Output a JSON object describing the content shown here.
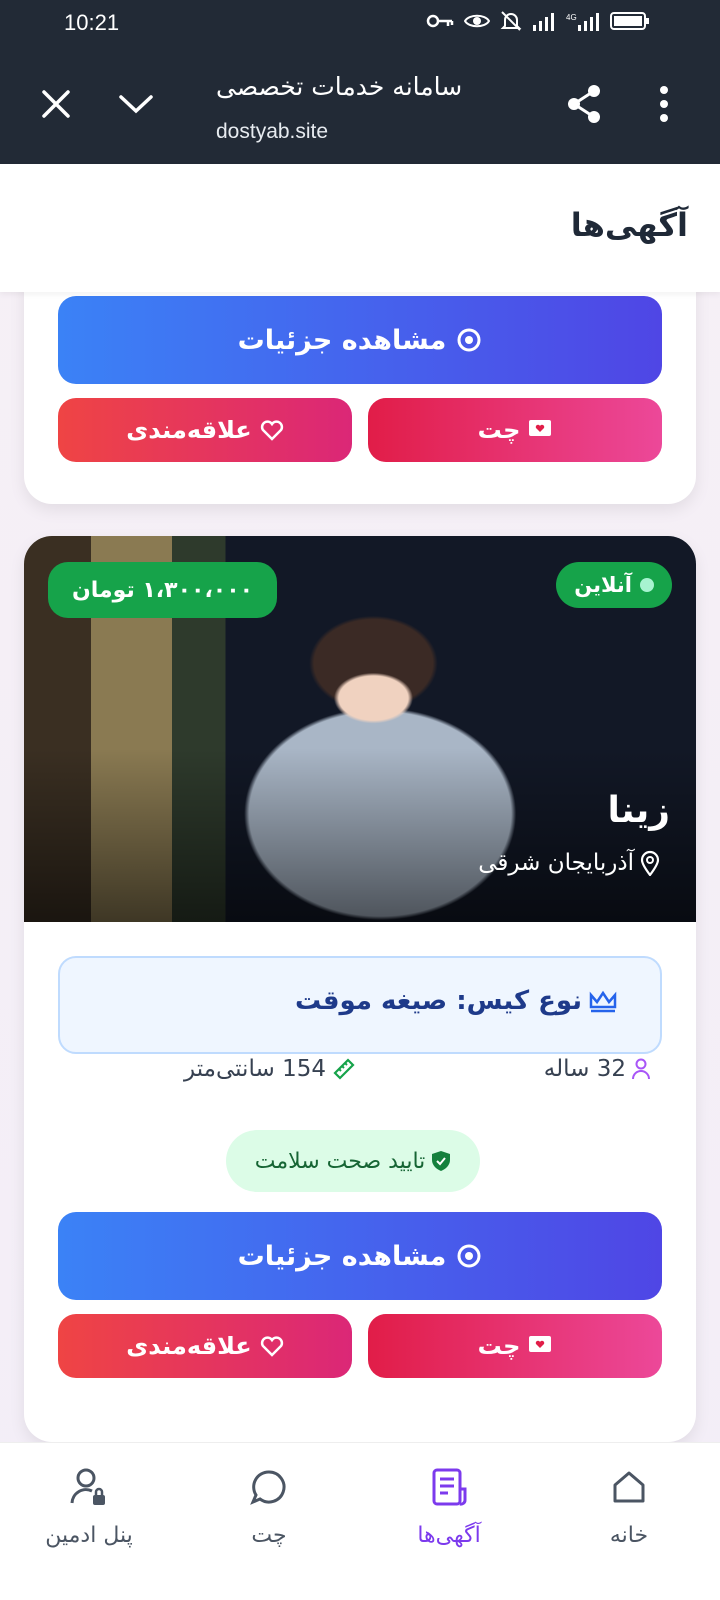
{
  "status_bar": {
    "time": "10:21"
  },
  "browser": {
    "title": "سامانه خدمات تخصصی",
    "url": "dostyab.site"
  },
  "page": {
    "title": "آگهی‌ها"
  },
  "top_card": {
    "details_label": "مشاهده جزئیات",
    "chat_label": "چت",
    "favorite_label": "علاقه‌مندی"
  },
  "listing": {
    "status": "آنلاین",
    "price": "۱،۳۰۰،۰۰۰ تومان",
    "name": "زینا",
    "location": "آذربایجان شرقی",
    "case_type": "نوع کیس: صیغه موقت",
    "age": "32 ساله",
    "height": "154 سانتی‌متر",
    "health": "تایید صحت سلامت",
    "details_label": "مشاهده جزئیات",
    "chat_label": "چت",
    "favorite_label": "علاقه‌مندی"
  },
  "bottom_nav": {
    "home": "خانه",
    "ads": "آگهی‌ها",
    "chat": "چت",
    "admin": "پنل ادمین"
  },
  "colors": {
    "header_bg": "#222a36",
    "accent": "#7c3aed",
    "online_badge": "#16a34a",
    "details_gradient_start": "#3b82f6",
    "details_gradient_end": "#4f46e5"
  }
}
